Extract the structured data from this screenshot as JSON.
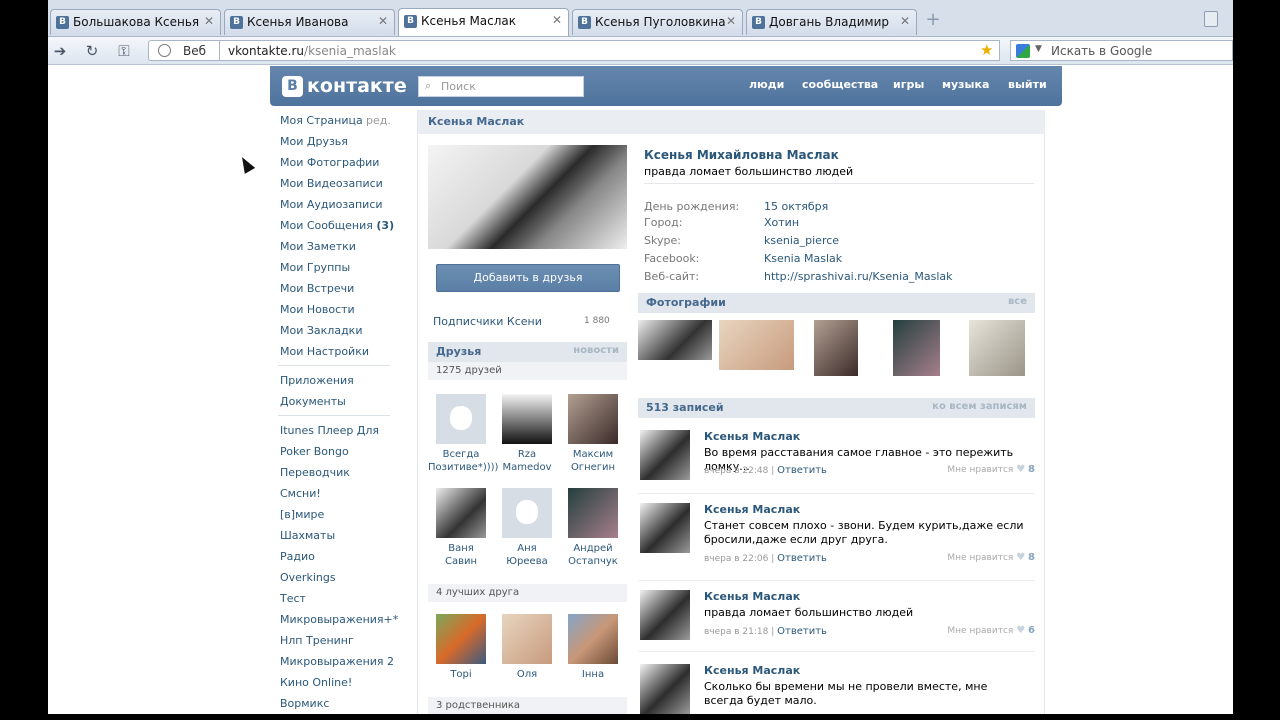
{
  "browser": {
    "tabs": [
      {
        "label": "Большакова Ксенья",
        "active": false
      },
      {
        "label": "Ксенья Иванова",
        "active": false
      },
      {
        "label": "Ксенья Маслак",
        "active": true
      },
      {
        "label": "Ксенья Пуголовкина",
        "active": false
      },
      {
        "label": "Довгань Владимир",
        "active": false
      }
    ],
    "web_label": "Веб",
    "url_host": "vkontakte.ru",
    "url_path": "/ksenia_maslak",
    "search_placeholder": "Искать в Google"
  },
  "vk": {
    "logo": "контакте",
    "logo_letter": "В",
    "search_placeholder": "Поиск",
    "top_links": [
      "люди",
      "сообщества",
      "игры",
      "музыка",
      "выйти"
    ],
    "menu": [
      {
        "label": "Моя Страница",
        "extra": "ред."
      },
      {
        "label": "Мои Друзья"
      },
      {
        "label": "Мои Фотографии"
      },
      {
        "label": "Мои Видеозаписи"
      },
      {
        "label": "Мои Аудиозаписи"
      },
      {
        "label": "Мои Сообщения",
        "count": "(3)"
      },
      {
        "label": "Мои Заметки"
      },
      {
        "label": "Мои Группы"
      },
      {
        "label": "Мои Встречи"
      },
      {
        "label": "Мои Новости"
      },
      {
        "label": "Мои Закладки"
      },
      {
        "label": "Мои Настройки"
      }
    ],
    "menu2": [
      "Приложения",
      "Документы"
    ],
    "apps": [
      "Itunes Плеер Для",
      "Poker Bongo",
      "Переводчик",
      "Смсни!",
      "[в]мире",
      "Шахматы",
      "Радио",
      "Overkings",
      "Тест",
      "Микровыражения+*",
      "Нлп Тренинг",
      "Микровыражения 2",
      "Кино Online!",
      "Вормикс"
    ]
  },
  "profile": {
    "title": "Ксенья Маслак",
    "full_name": "Ксенья Михайловна Маслак",
    "status": "правда ломает большинство людей",
    "info": [
      {
        "k": "День рождения:",
        "v": "15 октября"
      },
      {
        "k": "Город:",
        "v": "Хотин"
      },
      {
        "k": "Skype:",
        "v": "ksenia_pierce"
      },
      {
        "k": "Facebook:",
        "v": "Ksenia Maslak"
      },
      {
        "k": "Веб-сайт:",
        "v": "http://sprashivai.ru/Ksenia_Maslak"
      }
    ],
    "add_friend": "Добавить в друзья",
    "subscribers_label": "Подписчики Ксени",
    "subscribers_count": "1 880",
    "friends_head": "Друзья",
    "friends_link": "новости",
    "friends_count": "1275 друзей",
    "friends": [
      {
        "l1": "Всегда",
        "l2": "Позитиве*))))"
      },
      {
        "l1": "Rza",
        "l2": "Mamedov"
      },
      {
        "l1": "Максим",
        "l2": "Огнегин"
      },
      {
        "l1": "Ваня",
        "l2": "Савин"
      },
      {
        "l1": "Аня",
        "l2": "Юреева"
      },
      {
        "l1": "Андрей",
        "l2": "Остапчук"
      }
    ],
    "best_friends_count": "4 лучших друга",
    "best_friends": [
      "Торі",
      "Оля",
      "Інна"
    ],
    "relatives": "3 родственника",
    "photos_head": "Фотографии",
    "photos_link": "все",
    "wall_head": "513 записей",
    "wall_link": "ко всем записям",
    "posts": [
      {
        "name": "Ксенья Маслак",
        "text": "Во время расставания самое главное - это пережить ломку...",
        "date": "вчера в 22:48",
        "reply": "Ответить",
        "like_label": "Мне нравится",
        "likes": "8"
      },
      {
        "name": "Ксенья Маслак",
        "text": "Станет совсем плохо - звони. Будем курить,даже если бросили,даже если друг друга.",
        "date": "вчера в 22:06",
        "reply": "Ответить",
        "like_label": "Мне нравится",
        "likes": "8"
      },
      {
        "name": "Ксенья Маслак",
        "text": "правда ломает большинство людей",
        "date": "вчера в 21:18",
        "reply": "Ответить",
        "like_label": "Мне нравится",
        "likes": "6"
      },
      {
        "name": "Ксенья Маслак",
        "text": "Сколько бы времени мы не провели вместе, мне всегда будет мало."
      }
    ]
  }
}
